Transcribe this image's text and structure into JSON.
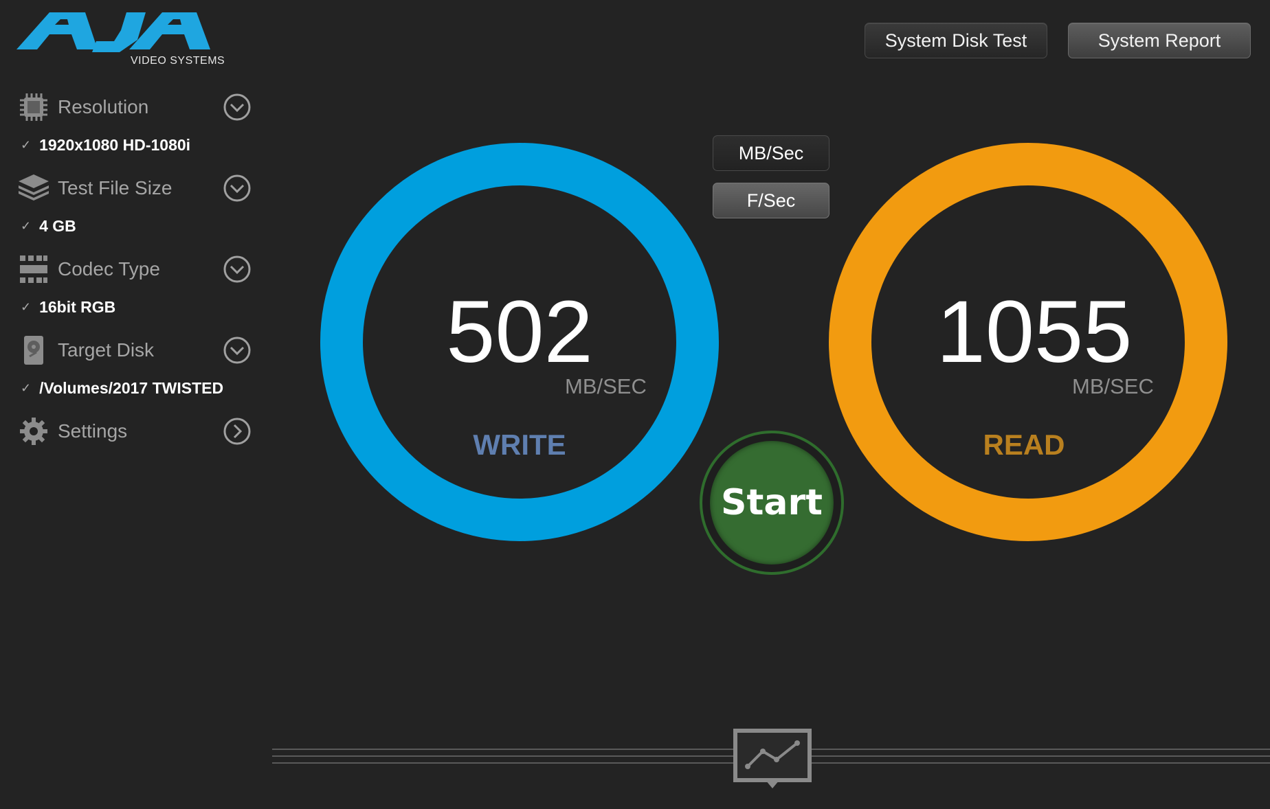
{
  "logo": {
    "subtitle": "VIDEO SYSTEMS"
  },
  "header": {
    "system_disk_test_label": "System Disk Test",
    "system_report_label": "System Report"
  },
  "sidebar": {
    "items": [
      {
        "label": "Resolution",
        "icon": "chip-icon",
        "value": "1920x1080 HD-1080i"
      },
      {
        "label": "Test File Size",
        "icon": "stack-icon",
        "value": "4 GB"
      },
      {
        "label": "Codec Type",
        "icon": "film-icon",
        "value": "16bit RGB"
      },
      {
        "label": "Target Disk",
        "icon": "hard-disk-icon",
        "value": "/Volumes/2017 TWISTED"
      },
      {
        "label": "Settings",
        "icon": "gear-icon"
      }
    ]
  },
  "units": {
    "mb_sec": "MB/Sec",
    "f_sec": "F/Sec"
  },
  "write": {
    "value": "502",
    "unit": "MB/SEC",
    "label": "WRITE",
    "color": "#009fde",
    "label_color": "#5f7fb0"
  },
  "read": {
    "value": "1055",
    "unit": "MB/SEC",
    "label": "READ",
    "color": "#f29b10",
    "label_color": "#b9801f"
  },
  "start": {
    "label": "Start",
    "color": "#356c31"
  },
  "footer": {
    "icon": "graph-icon"
  }
}
